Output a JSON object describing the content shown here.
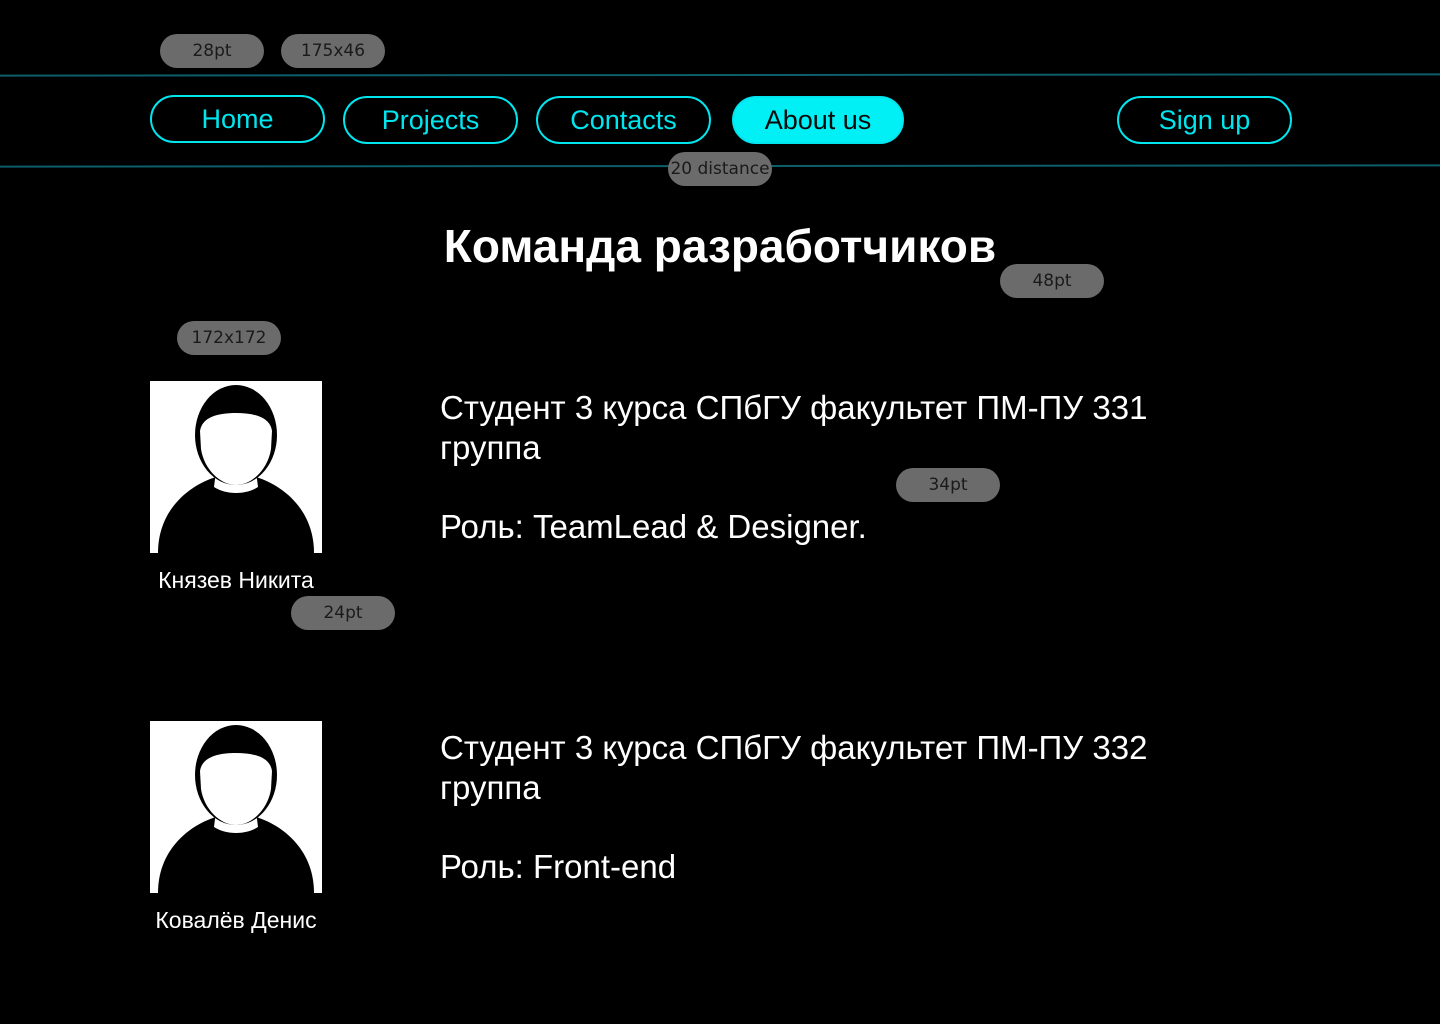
{
  "annotations": {
    "nav_font": "28pt",
    "nav_size": "175x46",
    "nav_gap": "20 distance",
    "title_font": "48pt",
    "avatar_size": "172x172",
    "desc_font": "34pt",
    "name_font": "24pt"
  },
  "nav": {
    "home": "Home",
    "projects": "Projects",
    "contacts": "Contacts",
    "about": "About us",
    "signup": "Sign up"
  },
  "page": {
    "title": "Команда разработчиков"
  },
  "team": [
    {
      "name": "Князев Никита",
      "desc": "Студент 3 курса СПбГУ факультет ПМ-ПУ 331 группа",
      "role": "Роль: TeamLead & Designer."
    },
    {
      "name": "Ковалёв Денис",
      "desc": "Студент 3 курса СПбГУ факультет ПМ-ПУ 332 группа",
      "role": "Роль: Front-end"
    }
  ],
  "colors": {
    "accent": "#00e5ee",
    "background": "#000000",
    "annotation": "#6b6b6b"
  },
  "icons": {
    "avatar": "user-silhouette-icon"
  }
}
